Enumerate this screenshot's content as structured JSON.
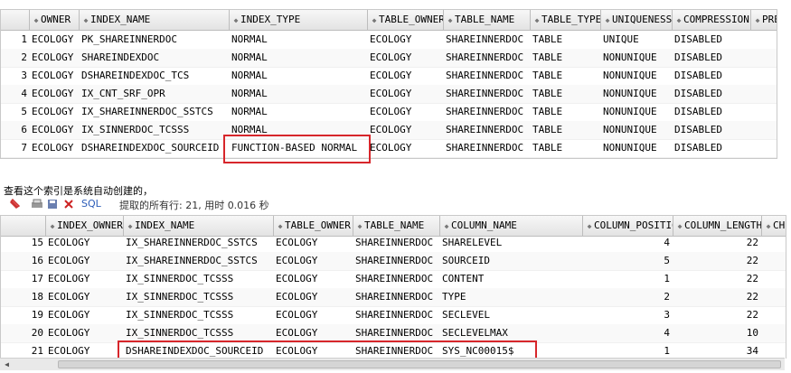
{
  "top_grid": {
    "columns": [
      "OWNER",
      "INDEX_NAME",
      "INDEX_TYPE",
      "TABLE_OWNER",
      "TABLE_NAME",
      "TABLE_TYPE",
      "UNIQUENESS",
      "COMPRESSION",
      "PRE"
    ],
    "rows": [
      {
        "n": "1",
        "cells": [
          "ECOLOGY",
          "PK_SHAREINNERDOC",
          "NORMAL",
          "ECOLOGY",
          "SHAREINNERDOC",
          "TABLE",
          "UNIQUE",
          "DISABLED"
        ]
      },
      {
        "n": "2",
        "cells": [
          "ECOLOGY",
          "SHAREINDEXDOC",
          "NORMAL",
          "ECOLOGY",
          "SHAREINNERDOC",
          "TABLE",
          "NONUNIQUE",
          "DISABLED"
        ]
      },
      {
        "n": "3",
        "cells": [
          "ECOLOGY",
          "DSHAREINDEXDOC_TCS",
          "NORMAL",
          "ECOLOGY",
          "SHAREINNERDOC",
          "TABLE",
          "NONUNIQUE",
          "DISABLED"
        ]
      },
      {
        "n": "4",
        "cells": [
          "ECOLOGY",
          "IX_CNT_SRF_OPR",
          "NORMAL",
          "ECOLOGY",
          "SHAREINNERDOC",
          "TABLE",
          "NONUNIQUE",
          "DISABLED"
        ]
      },
      {
        "n": "5",
        "cells": [
          "ECOLOGY",
          "IX_SHAREINNERDOC_SSTCS",
          "NORMAL",
          "ECOLOGY",
          "SHAREINNERDOC",
          "TABLE",
          "NONUNIQUE",
          "DISABLED"
        ]
      },
      {
        "n": "6",
        "cells": [
          "ECOLOGY",
          "IX_SINNERDOC_TCSSS",
          "NORMAL",
          "ECOLOGY",
          "SHAREINNERDOC",
          "TABLE",
          "NONUNIQUE",
          "DISABLED"
        ]
      },
      {
        "n": "7",
        "cells": [
          "ECOLOGY",
          "DSHAREINDEXDOC_SOURCEID",
          "FUNCTION-BASED NORMAL",
          "ECOLOGY",
          "SHAREINNERDOC",
          "TABLE",
          "NONUNIQUE",
          "DISABLED"
        ]
      }
    ]
  },
  "caption": "查看这个索引是系统自动创建的，",
  "toolbar": {
    "sql_label": "SQL",
    "status": "提取的所有行: 21, 用时 0.016 秒"
  },
  "bottom_grid": {
    "columns": [
      "INDEX_OWNER",
      "INDEX_NAME",
      "TABLE_OWNER",
      "TABLE_NAME",
      "COLUMN_NAME",
      "COLUMN_POSITION",
      "COLUMN_LENGTH",
      "CH"
    ],
    "rows": [
      {
        "n": "15",
        "cells": [
          "ECOLOGY",
          "IX_SHAREINNERDOC_SSTCS",
          "ECOLOGY",
          "SHAREINNERDOC",
          "SHARELEVEL",
          "4",
          "22"
        ]
      },
      {
        "n": "16",
        "cells": [
          "ECOLOGY",
          "IX_SHAREINNERDOC_SSTCS",
          "ECOLOGY",
          "SHAREINNERDOC",
          "SOURCEID",
          "5",
          "22"
        ]
      },
      {
        "n": "17",
        "cells": [
          "ECOLOGY",
          "IX_SINNERDOC_TCSSS",
          "ECOLOGY",
          "SHAREINNERDOC",
          "CONTENT",
          "1",
          "22"
        ]
      },
      {
        "n": "18",
        "cells": [
          "ECOLOGY",
          "IX_SINNERDOC_TCSSS",
          "ECOLOGY",
          "SHAREINNERDOC",
          "TYPE",
          "2",
          "22"
        ]
      },
      {
        "n": "19",
        "cells": [
          "ECOLOGY",
          "IX_SINNERDOC_TCSSS",
          "ECOLOGY",
          "SHAREINNERDOC",
          "SECLEVEL",
          "3",
          "22"
        ]
      },
      {
        "n": "20",
        "cells": [
          "ECOLOGY",
          "IX_SINNERDOC_TCSSS",
          "ECOLOGY",
          "SHAREINNERDOC",
          "SECLEVELMAX",
          "4",
          "10"
        ]
      },
      {
        "n": "21",
        "cells": [
          "ECOLOGY",
          "DSHAREINDEXDOC_SOURCEID",
          "ECOLOGY",
          "SHAREINNERDOC",
          "SYS_NC00015$",
          "1",
          "34"
        ]
      }
    ]
  },
  "colors": {
    "highlight": "#d7262b"
  }
}
